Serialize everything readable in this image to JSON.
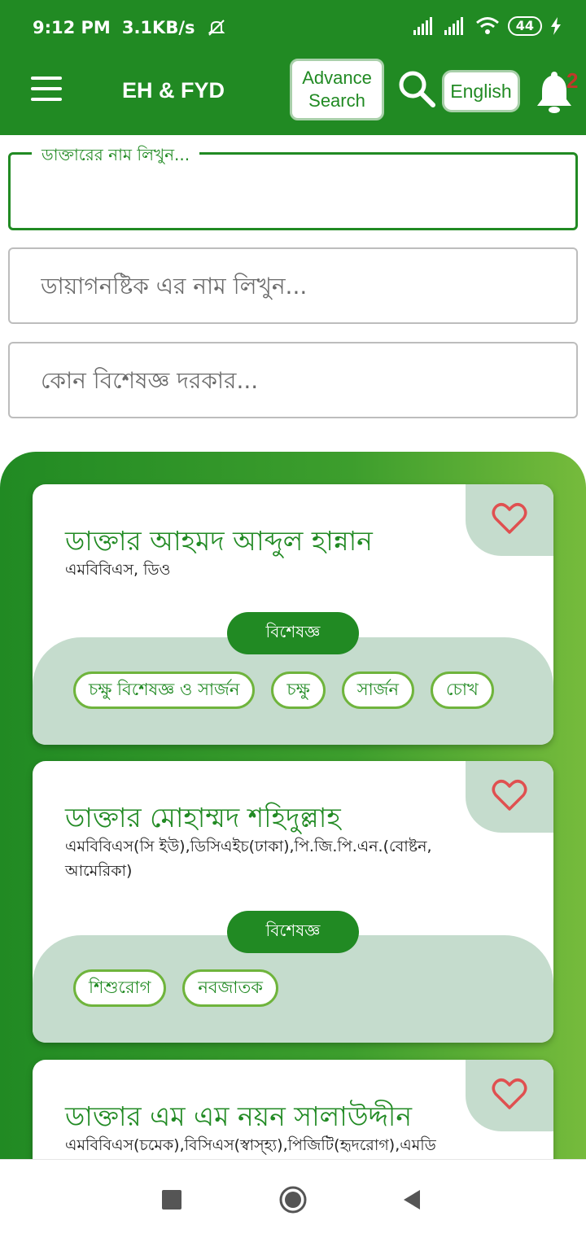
{
  "status": {
    "time": "9:12 PM",
    "speed": "3.1KB/s",
    "battery": "44"
  },
  "appbar": {
    "title": "EH & FYD",
    "advance_search_line1": "Advance",
    "advance_search_line2": "Search",
    "language": "English",
    "notification_count": "2"
  },
  "filters": {
    "doctor_label": "ডাক্তারের নাম লিখুন...",
    "diagnostic_placeholder": "ডায়াগনষ্টিক এর নাম লিখুন...",
    "specialist_placeholder": "কোন বিশেষজ্ঞ দরকার..."
  },
  "colors": {
    "primary": "#218A23",
    "accent_light": "#c5dccd",
    "tag_border": "#6fb43c",
    "heart": "#e05050"
  },
  "doctors": [
    {
      "name": "ডাক্তার আহমদ আব্দুল হান্নান",
      "degree": "এমবিবিএস,  ডিও",
      "specialist_label": "বিশেষজ্ঞ",
      "tags": [
        "চক্ষু বিশেষজ্ঞ ও সার্জন",
        "চক্ষু",
        "সার্জন",
        "চোখ"
      ]
    },
    {
      "name": "ডাক্তার মোহাম্মদ শহিদুল্লাহ",
      "degree": "এমবিবিএস(সি ইউ),ডিসিএইচ(ঢাকা),পি.জি.পি.এন.(বোষ্টন,আমেরিকা)",
      "specialist_label": "বিশেষজ্ঞ",
      "tags": [
        "শিশুরোগ",
        "নবজাতক"
      ]
    },
    {
      "name": "ডাক্তার এম এম নয়ন সালাউদ্দীন",
      "degree": "এমবিবিএস(চমেক),বিসিএস(স্বাস্হ্য),পিজিটি(হৃদরোগ),এমডি"
    }
  ],
  "icons": [
    "menu-icon",
    "search-icon",
    "bell-icon",
    "heart-icon",
    "stop-icon",
    "home-icon",
    "back-icon"
  ]
}
